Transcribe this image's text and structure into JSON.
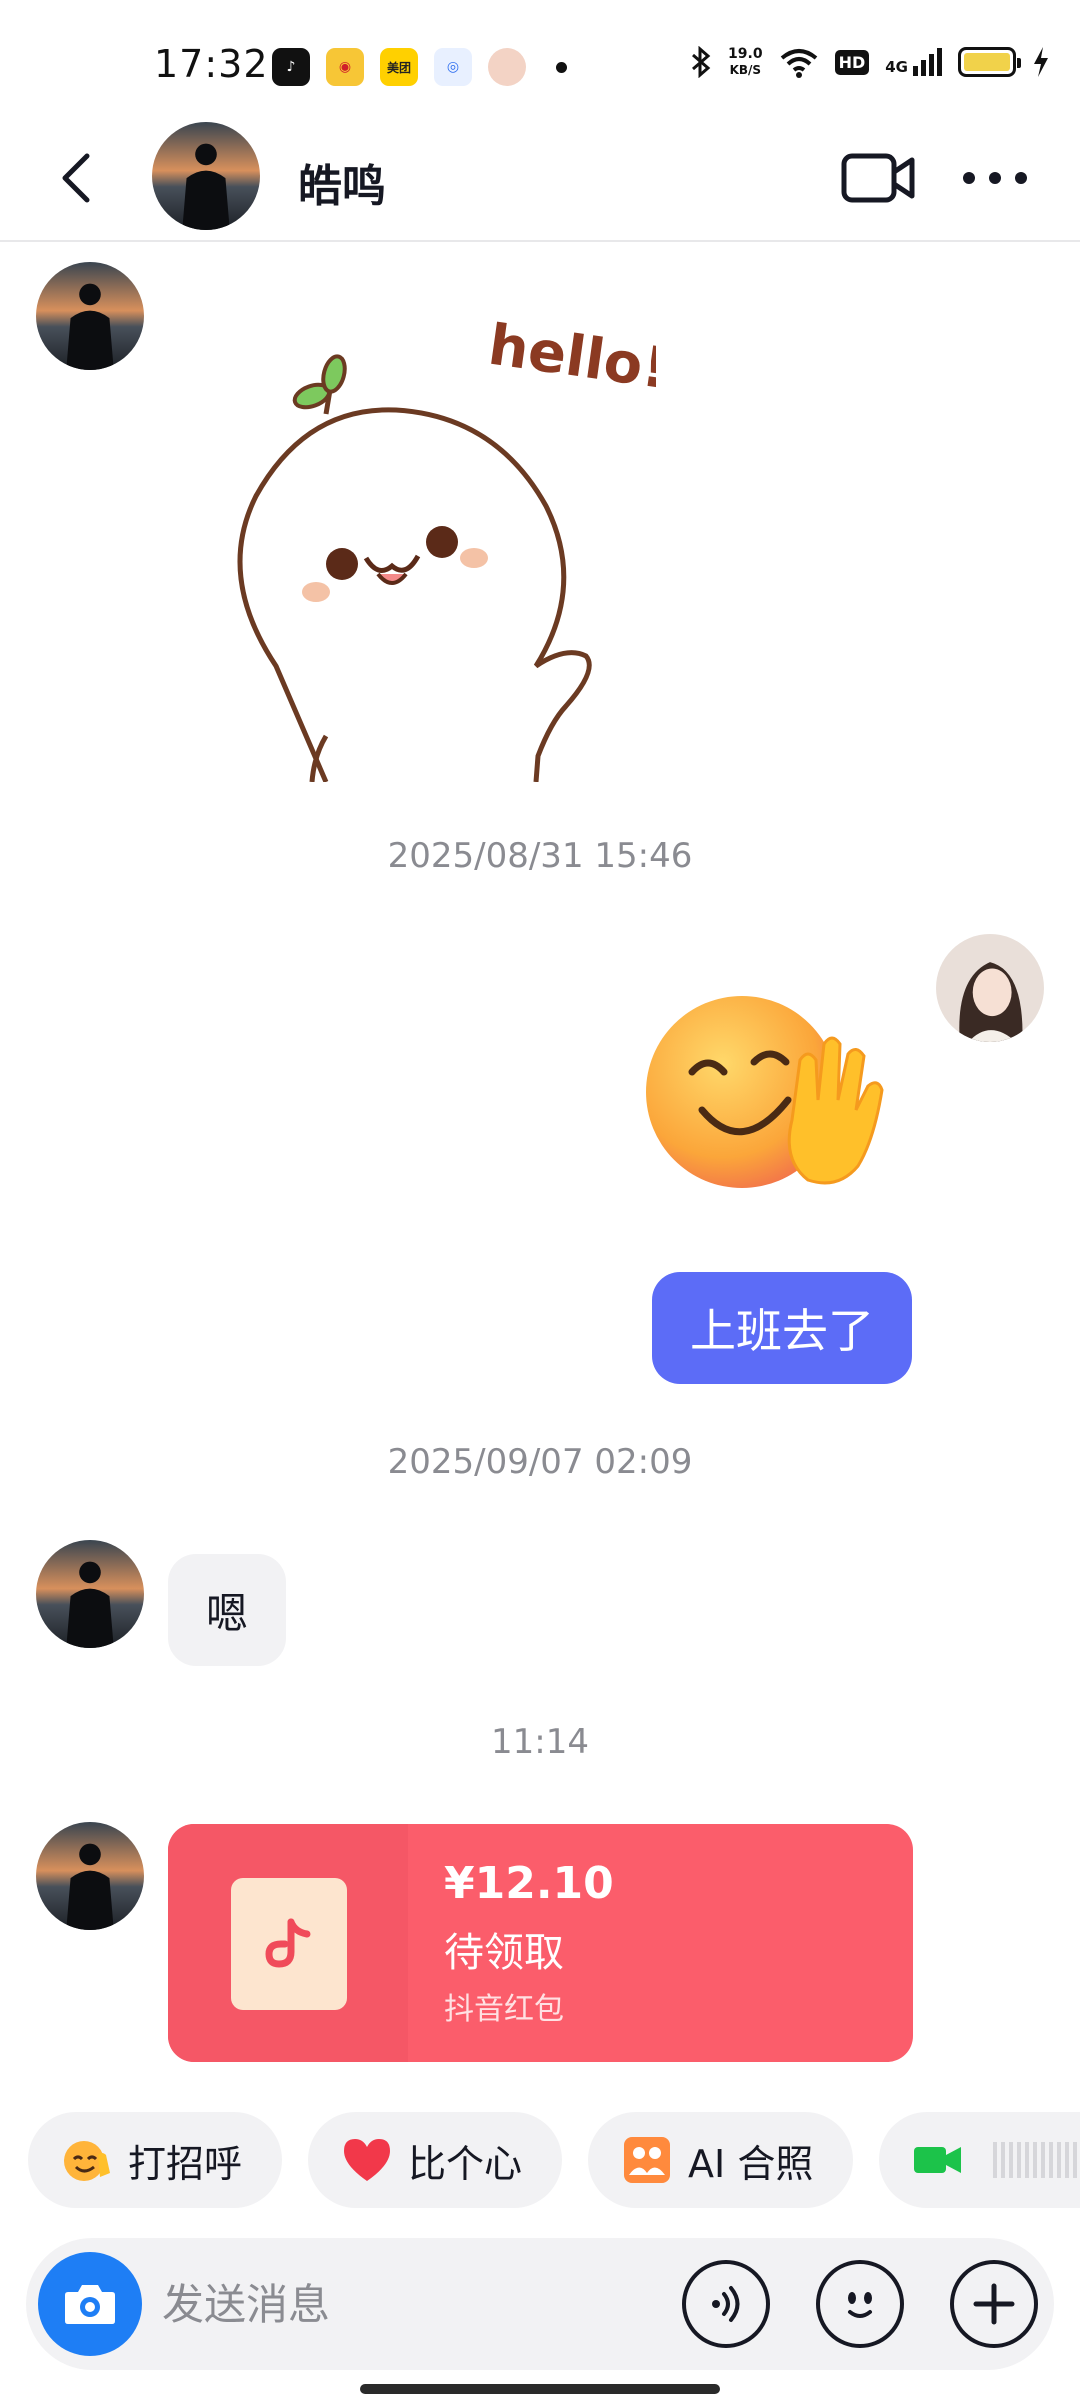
{
  "status_bar": {
    "time": "17:32",
    "app_icons": [
      "tiktok-icon",
      "weibo-icon",
      "meituan-icon",
      "baidu-map-icon",
      "avatar-icon"
    ],
    "meituan_label": "美团",
    "net_speed_value": "19.0",
    "net_speed_unit": "KB/S",
    "hd_label": "HD",
    "network_label": "4G",
    "battery_color": "#f1d24a"
  },
  "header": {
    "contact_name": "皓鸣"
  },
  "messages": {
    "ts1": "2025/08/31 15:46",
    "me_text": "上班去了",
    "ts2": "2025/09/07 02:09",
    "him_text": "嗯",
    "ts3": "11:14",
    "sticker_text": "hello!"
  },
  "red_packet": {
    "amount": "¥12.10",
    "status": "待领取",
    "label": "抖音红包",
    "color": "#fb5d6b"
  },
  "quick_actions": [
    {
      "icon": "wave-emoji-icon",
      "label": "打招呼"
    },
    {
      "icon": "heart-icon",
      "label": "比个心"
    },
    {
      "icon": "ai-photo-icon",
      "label": "AI 合照"
    },
    {
      "icon": "video-call-icon",
      "label": ""
    }
  ],
  "input": {
    "placeholder": "发送消息"
  },
  "colors": {
    "accent_blue": "#1e7ef5",
    "my_bubble": "#5c6cf7"
  }
}
